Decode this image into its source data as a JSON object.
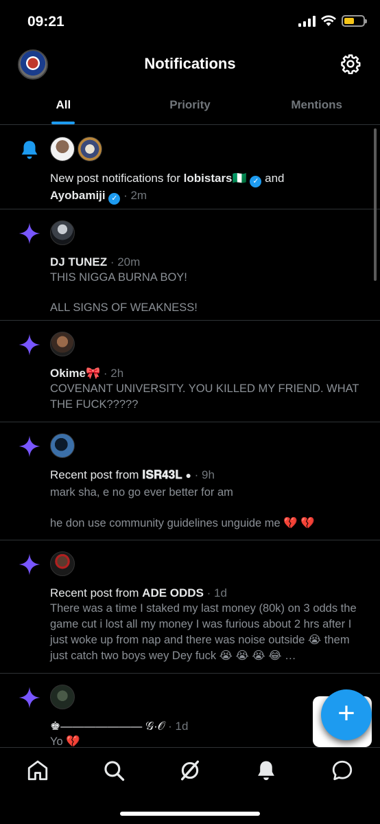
{
  "status_bar": {
    "time": "09:21"
  },
  "header": {
    "title": "Notifications",
    "logo_icon": "profile-logo",
    "settings_icon": "gear-icon"
  },
  "tabs": [
    {
      "label": "All",
      "active": true
    },
    {
      "label": "Priority",
      "active": false
    },
    {
      "label": "Mentions",
      "active": false
    }
  ],
  "notifications": [
    {
      "icon": "bell-icon",
      "prefix": "New post notifications for ",
      "name1": "lobistars🇳🇬",
      "and": " and",
      "name2": "Ayobamiji",
      "time": " · 2m"
    },
    {
      "icon": "sparkle-icon",
      "name": "DJ TUNEZ",
      "time": " · 20m",
      "body1": "THIS NIGGA BURNA BOY!",
      "body2": "ALL SIGNS OF WEAKNESS!"
    },
    {
      "icon": "sparkle-icon",
      "name": "Okime🎀",
      "time": " · 2h",
      "body1": "COVENANT UNIVERSITY. YOU KILLED MY FRIEND. WHAT THE FUCK?????"
    },
    {
      "icon": "sparkle-icon",
      "prefix": "Recent post from ",
      "name": "𝐈𝐒𝐑𝟒𝟑𝐋 ",
      "time": " · 9h",
      "body1": "mark sha, e no go ever better for am",
      "body2": "he don use community guidelines unguide me 💔 💔"
    },
    {
      "icon": "sparkle-icon",
      "prefix": "Recent post from ",
      "name": "ADE ODDS",
      "time": " · 1d",
      "body1": "There was a time I staked my last money (80k) on 3 odds the game cut i lost all my money I was furious about 2 hrs after I just woke up from nap and there was noise outside 😭 them just catch two boys wey Dey fuck 😭 😭 😭 😂 …"
    },
    {
      "icon": "sparkle-icon",
      "name": "♚——————— 𝒢·𝒪",
      "time": " · 1d",
      "body1": "Yo 💔"
    }
  ],
  "fab": {
    "label": "+"
  },
  "bottom_nav": [
    "home-icon",
    "search-icon",
    "grok-icon",
    "notifications-icon",
    "messages-icon"
  ]
}
